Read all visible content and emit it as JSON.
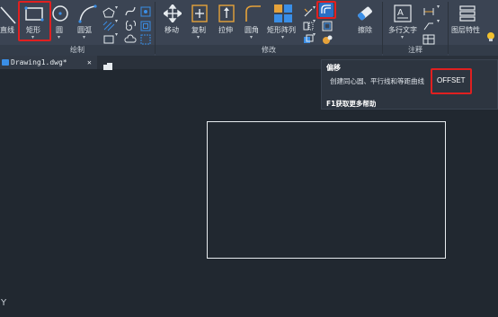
{
  "ribbon": {
    "groups": [
      "绘制",
      "修改",
      "注释"
    ],
    "draw_tools": {
      "line": "直线",
      "rectangle": "矩形",
      "circle": "圆",
      "arc": "圆弧"
    },
    "modify_tools": {
      "move": "移动",
      "copy": "复制",
      "stretch": "拉伸",
      "fillet": "圆角",
      "rect_array": "矩形阵列",
      "erase": "擦除"
    },
    "annotation_tools": {
      "mtext": "多行文字"
    },
    "layer_tools": {
      "layer_props": "图层特性"
    }
  },
  "tabs": {
    "document": "Drawing1.dwg*",
    "close": "✕"
  },
  "tooltip": {
    "title": "偏移",
    "description": "创建同心圆、平行线和等距曲线",
    "command": "OFFSET",
    "help": "F1获取更多帮助"
  },
  "canvas": {
    "ucs_y": "Y"
  },
  "colors": {
    "ribbon_bg": "#3b4453",
    "canvas_bg": "#212830",
    "highlight": "#e02020",
    "accent_blue": "#3a8ee6"
  }
}
